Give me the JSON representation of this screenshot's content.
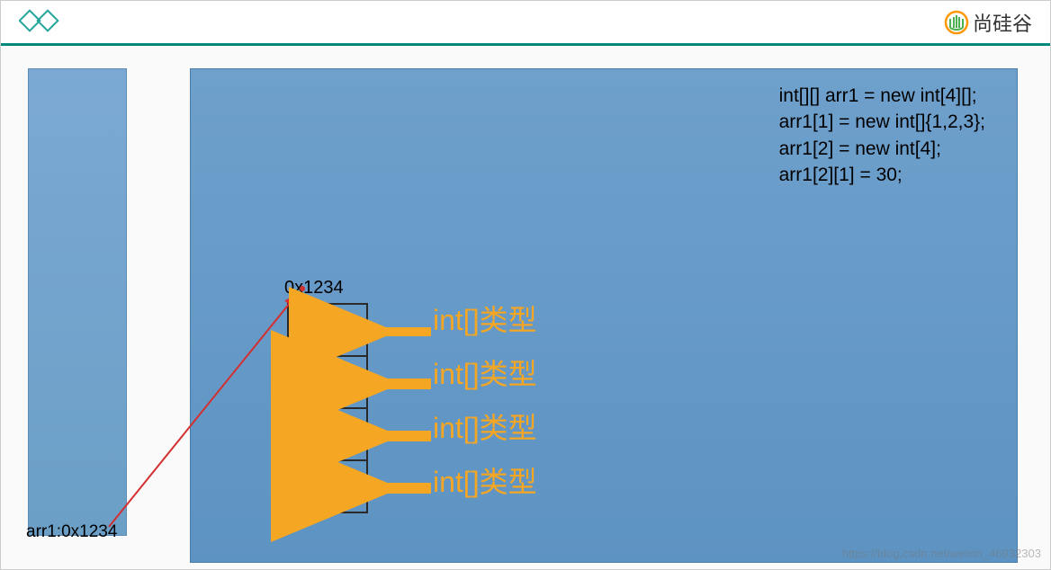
{
  "header": {
    "brand": "尚硅谷"
  },
  "stack": {
    "var_label": "arr1:0x1234"
  },
  "heap": {
    "address": "0x1234",
    "cells": [
      "null",
      "null",
      "null",
      "null"
    ],
    "type_labels": [
      "int[]类型",
      "int[]类型",
      "int[]类型",
      "int[]类型"
    ]
  },
  "code": {
    "line1": "int[][] arr1 = new int[4][];",
    "line2": "arr1[1] = new int[]{1,2,3};",
    "line3": "arr1[2] = new int[4];",
    "line4": "arr1[2][1] = 30;"
  },
  "watermark": "https://blog.csdn.net/weixin_46932303"
}
